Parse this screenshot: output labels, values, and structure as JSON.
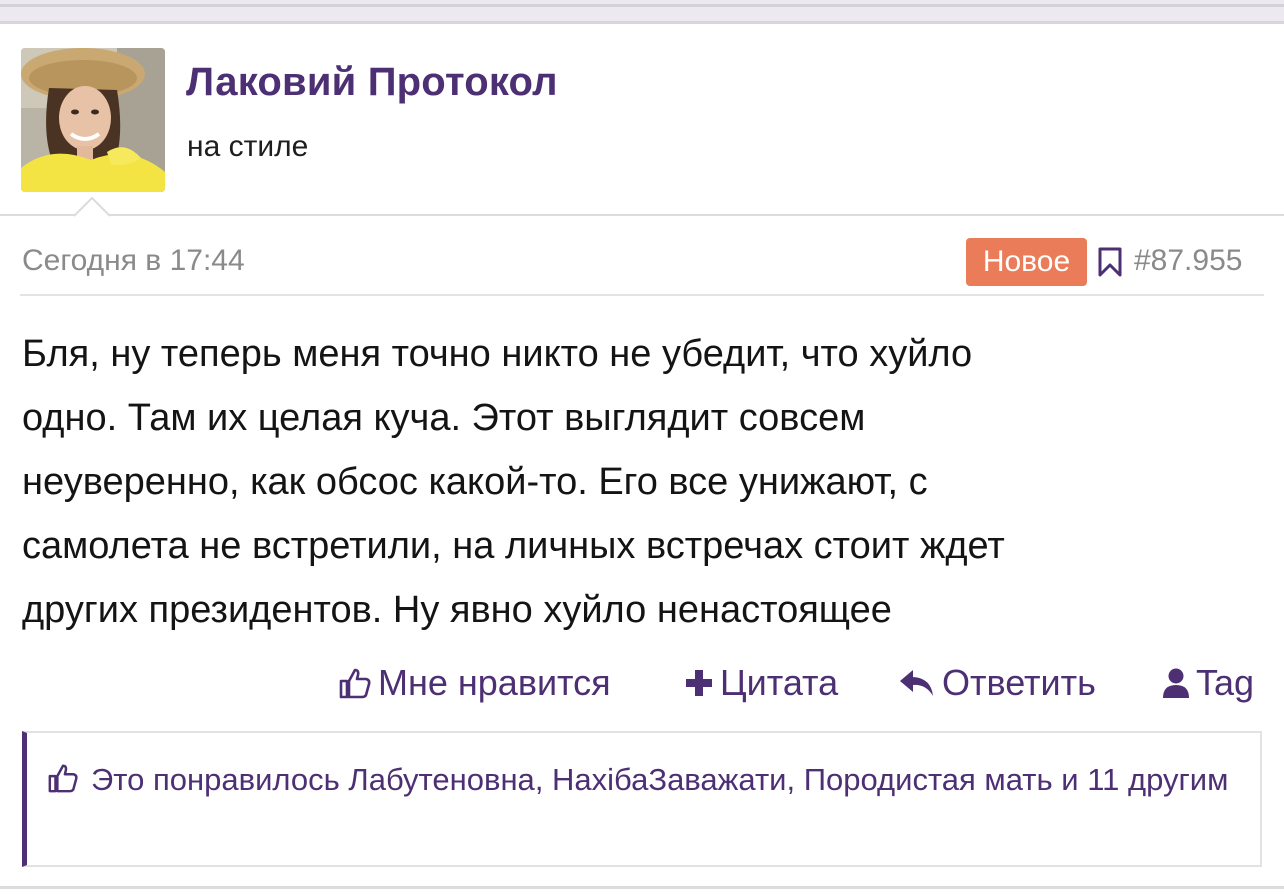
{
  "author": {
    "name": "Лаковий Протокол",
    "title": "на стиле"
  },
  "post": {
    "date": "Сегодня в 17:44",
    "badge": "Новое",
    "number": "#87.955",
    "lines": [
      "Бля, ну теперь меня точно никто не убедит, что хуйло",
      "одно. Там их целая куча. Этот выглядит совсем",
      "неуверенно, как обсос какой-то. Его все унижают, с",
      "самолета не встретили, на личных встречах стоит ждет",
      "других президентов. Ну явно хуйло ненастоящее"
    ]
  },
  "actions": {
    "like": "Мне нравится",
    "quote": "Цитата",
    "reply": "Ответить",
    "tag": "Tag"
  },
  "likes": {
    "prefix": "Это понравилось",
    "users": [
      "Лабутеновна",
      "НахібаЗаважати",
      "Породистая мать"
    ],
    "suffix": "и 11 другим"
  },
  "colors": {
    "accent": "#4d2f73",
    "badge": "#ea7c59",
    "muted": "#8a8a8a"
  },
  "icons": [
    "like-icon",
    "plus-icon",
    "reply-icon",
    "user-icon",
    "bookmark-icon"
  ]
}
